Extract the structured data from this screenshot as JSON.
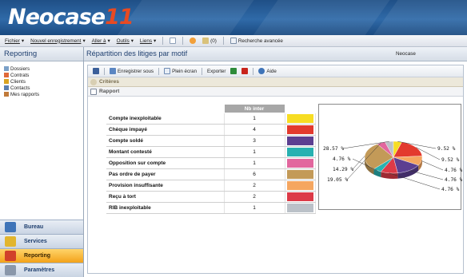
{
  "app": {
    "logo_text": "Neocase",
    "logo_version": "11"
  },
  "menubar": {
    "items": [
      {
        "label": "Fichier",
        "arrow": "▾"
      },
      {
        "label": "Nouvel enregistrement",
        "arrow": "▾"
      },
      {
        "label": "Aller à",
        "arrow": "▾"
      },
      {
        "label": "Outils",
        "arrow": "▾"
      },
      {
        "label": "Liens",
        "arrow": "▾"
      }
    ],
    "favorites_count": "(0)",
    "advanced_search_label": "Recherche avancée"
  },
  "sidebar": {
    "title": "Reporting",
    "tree": [
      {
        "label": "Dossiers",
        "icon": "folders-icon",
        "color": "#7aa0c8"
      },
      {
        "label": "Contrats",
        "icon": "contract-icon",
        "color": "#e06a3a"
      },
      {
        "label": "Clients",
        "icon": "clients-icon",
        "color": "#d9a321"
      },
      {
        "label": "Contacts",
        "icon": "contacts-icon",
        "color": "#5b7fb0"
      },
      {
        "label": "Mes rapports",
        "icon": "reports-icon",
        "color": "#c07a3a"
      }
    ],
    "nav_buttons": [
      {
        "label": "Bureau",
        "icon": "desk-icon",
        "color": "#3f74b8",
        "active": false
      },
      {
        "label": "Services",
        "icon": "services-icon",
        "color": "#e2b52e",
        "active": false
      },
      {
        "label": "Reporting",
        "icon": "reporting-icon",
        "color": "#d1412a",
        "active": true
      },
      {
        "label": "Paramètres",
        "icon": "settings-icon",
        "color": "#8a97aa",
        "active": false
      }
    ]
  },
  "main": {
    "title": "Répartition des litiges par motif",
    "brand": "Neocase",
    "toolbar": {
      "save_as": "Enregistrer sous",
      "fullscreen": "Plein écran",
      "export": "Exporter",
      "help": "Aide"
    },
    "section_criteria": "Critères",
    "section_report": "Rapport",
    "table": {
      "header_count": "Nb inter",
      "rows": [
        {
          "label": "Compte inexploitable",
          "count": "1",
          "color": "#f7dd22"
        },
        {
          "label": "Chèque impayé",
          "count": "4",
          "color": "#e33a2e"
        },
        {
          "label": "Compte soldé",
          "count": "3",
          "color": "#5c3f91"
        },
        {
          "label": "Montant contesté",
          "count": "1",
          "color": "#28b1b1"
        },
        {
          "label": "Opposition sur compte",
          "count": "1",
          "color": "#e2679e"
        },
        {
          "label": "Pas ordre de payer",
          "count": "6",
          "color": "#c39a58"
        },
        {
          "label": "Provision insuffisante",
          "count": "2",
          "color": "#f5a660"
        },
        {
          "label": "Reçu à tort",
          "count": "2",
          "color": "#dc3a47"
        },
        {
          "label": "RIB inexploitable",
          "count": "1",
          "color": "#bbc1c8"
        }
      ]
    }
  },
  "chart_data": {
    "type": "pie",
    "categories": [
      "Compte inexploitable",
      "Chèque impayé",
      "Compte soldé",
      "Montant contesté",
      "Opposition sur compte",
      "Pas ordre de payer",
      "Provision insuffisante",
      "Reçu à tort",
      "RIB inexploitable"
    ],
    "values": [
      1,
      4,
      3,
      1,
      1,
      6,
      2,
      2,
      1
    ],
    "colors": [
      "#f7dd22",
      "#e33a2e",
      "#5c3f91",
      "#28b1b1",
      "#e2679e",
      "#c39a58",
      "#f5a660",
      "#dc3a47",
      "#bbc1c8"
    ],
    "labels": [
      "9.52 %",
      "9.52 %",
      "4.76 %",
      "4.76 %",
      "19.05 %",
      "14.29 %",
      "4.76 %",
      "4.76 %",
      "28.57 %"
    ]
  }
}
